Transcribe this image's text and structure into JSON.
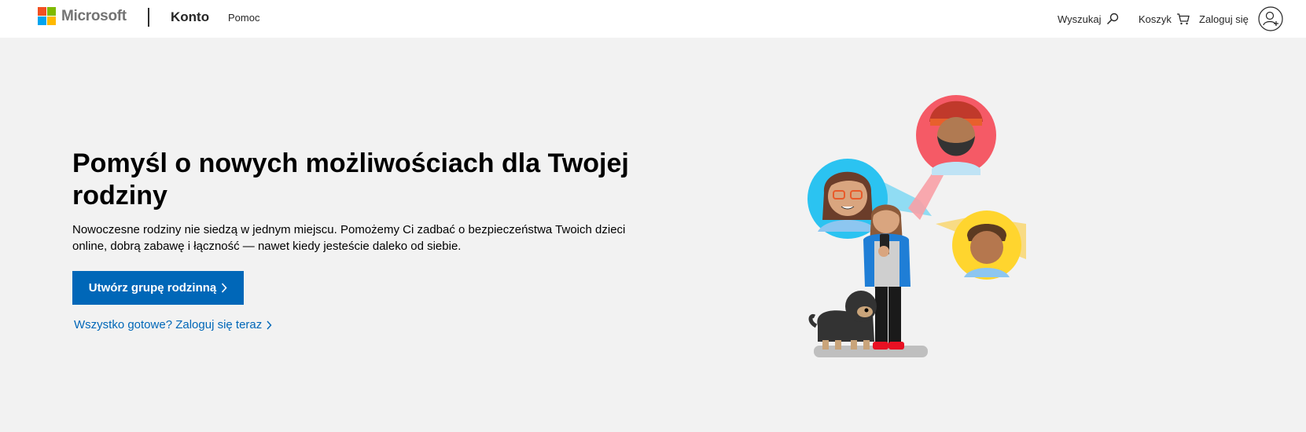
{
  "header": {
    "logo_text": "Microsoft",
    "logo_colors": [
      "#f25022",
      "#7fba00",
      "#00a4ef",
      "#ffb900"
    ],
    "brand": "Konto",
    "nav_help": "Pomoc",
    "search_label": "Wyszukaj",
    "cart_label": "Koszyk",
    "signin_label": "Zaloguj się",
    "icons": {
      "search": "search-icon",
      "cart": "cart-icon",
      "user": "user-avatar-icon"
    }
  },
  "hero": {
    "title": "Pomyśl o nowych możliwościach dla Twojej rodziny",
    "text": "Nowoczesne rodziny nie siedzą w jednym miejscu. Pomożemy Ci zadbać o bezpieczeństwa Twoich dzieci online, dobrą zabawę i łączność — nawet kiedy jesteście daleko od siebie.",
    "cta_label": "Utwórz grupę rodzinną",
    "signin_link": "Wszystko gotowe? Zaloguj się teraz"
  },
  "colors": {
    "accent": "#0067b8",
    "background": "#f2f2f2",
    "circle_blue": "#2bc3f1",
    "circle_red": "#f55a66",
    "circle_yellow": "#ffd52e"
  }
}
